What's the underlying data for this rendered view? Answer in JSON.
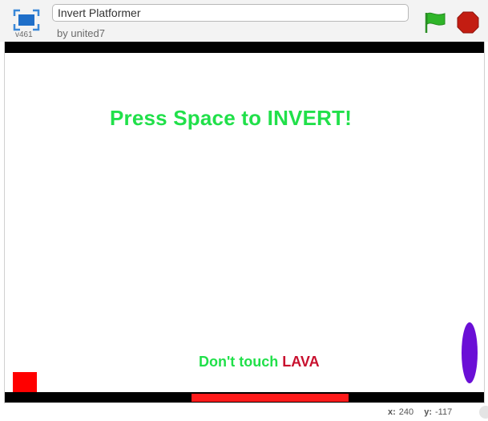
{
  "header": {
    "version": "v461",
    "project_title": "Invert Platformer",
    "author": "by united7"
  },
  "stage": {
    "headline": "Press Space to INVERT!",
    "hint_prefix": "Don't touch ",
    "hint_hazard": "LAVA"
  },
  "status": {
    "x_label": "x:",
    "x_value": "240",
    "y_label": "y:",
    "y_value": "-117"
  },
  "colors": {
    "headline": "#21e04a",
    "hint": "#21e04a",
    "hazard_text": "#c8102e",
    "lava": "#ff1a1a",
    "player": "#ff0000",
    "portal": "#6a0fd6",
    "flag": "#2fb529",
    "stop": "#c31d12"
  },
  "icons": {
    "fullscreen": "fullscreen-icon",
    "green_flag": "green-flag-icon",
    "stop": "stop-sign-icon"
  }
}
